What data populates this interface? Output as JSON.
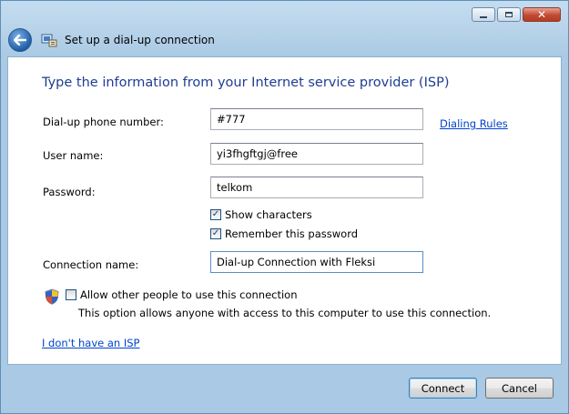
{
  "window": {
    "title": "Set up a dial-up connection",
    "controls": {
      "minimize": "minimize",
      "maximize": "maximize",
      "close": "✕"
    }
  },
  "form": {
    "heading": "Type the information from your Internet service provider (ISP)",
    "phone": {
      "label": "Dial-up phone number:",
      "value": "#777"
    },
    "dialing_rules_link": "Dialing Rules",
    "username": {
      "label": "User name:",
      "value": "yi3fhgftgj@free"
    },
    "password": {
      "label": "Password:",
      "value": "telkom"
    },
    "show_characters": {
      "label": "Show characters",
      "checked": true
    },
    "remember_password": {
      "label": "Remember this password",
      "checked": true
    },
    "connection_name": {
      "label": "Connection name:",
      "value": "Dial-up Connection with Fleksi"
    },
    "allow_others": {
      "label": "Allow other people to use this connection",
      "checked": false
    },
    "allow_note": "This option allows anyone with access to this computer to use this connection.",
    "no_isp_link": "I don't have an ISP"
  },
  "footer": {
    "connect_label": "Connect",
    "cancel_label": "Cancel"
  },
  "icons": {
    "back": "back-arrow-icon",
    "app": "dialup-connection-icon",
    "shield": "uac-shield-icon",
    "check": "✓"
  },
  "colors": {
    "heading": "#1e3d92",
    "link": "#0044cc",
    "frame": "#a9c9e4"
  }
}
